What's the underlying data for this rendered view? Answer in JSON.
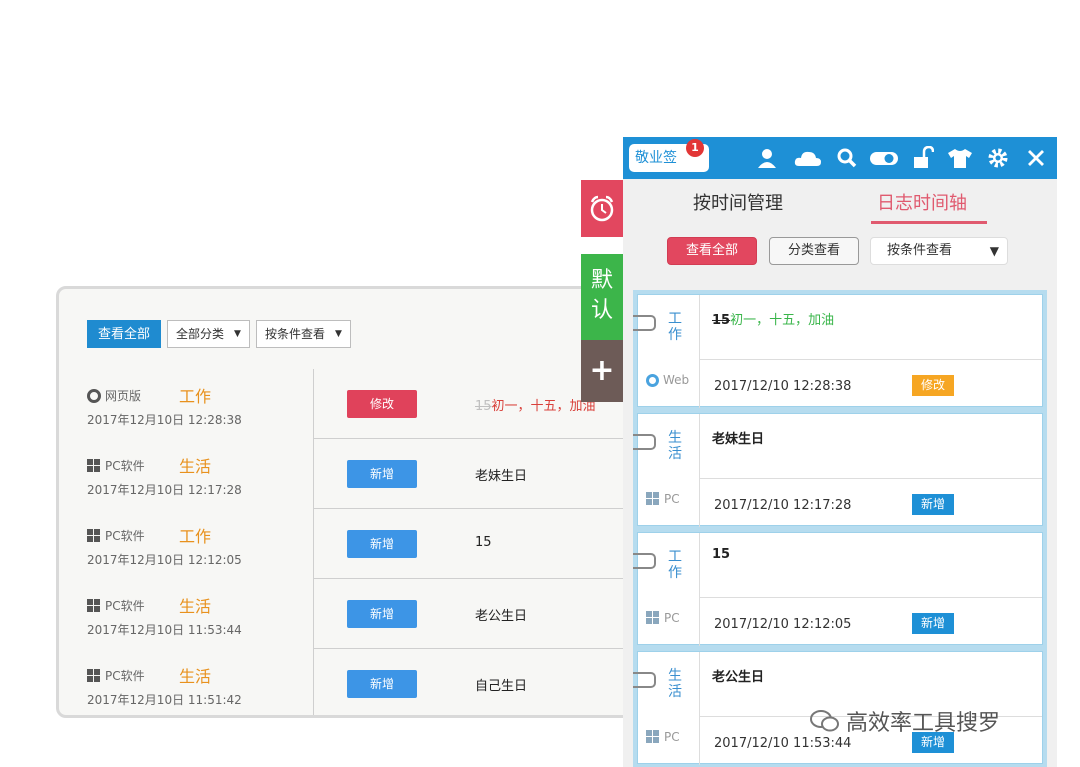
{
  "left": {
    "toolbar": {
      "view_all": "查看全部",
      "category_select": "全部分类",
      "condition_select": "按条件查看"
    },
    "rows": [
      {
        "source": "网页版",
        "source_icon": "ie-icon",
        "category": "工作",
        "time": "2017年12月10日 12:28:38",
        "action": "修改",
        "content_prefix": "15",
        "content": "初一，十五，加油"
      },
      {
        "source": "PC软件",
        "source_icon": "windows-icon",
        "category": "生活",
        "time": "2017年12月10日 12:17:28",
        "action": "新增",
        "content_prefix": "",
        "content": "老妹生日"
      },
      {
        "source": "PC软件",
        "source_icon": "windows-icon",
        "category": "工作",
        "time": "2017年12月10日 12:12:05",
        "action": "新增",
        "content_prefix": "",
        "content": "15"
      },
      {
        "source": "PC软件",
        "source_icon": "windows-icon",
        "category": "生活",
        "time": "2017年12月10日 11:53:44",
        "action": "新增",
        "content_prefix": "",
        "content": "老公生日"
      },
      {
        "source": "PC软件",
        "source_icon": "windows-icon",
        "category": "生活",
        "time": "2017年12月10日 11:51:42",
        "action": "新增",
        "content_prefix": "",
        "content": "自己生日"
      }
    ]
  },
  "side_tabs": {
    "alarm_icon": "alarm-clock-icon",
    "default_label_line1": "默",
    "default_label_line2": "认",
    "add_label": "+"
  },
  "app": {
    "logo": "敬业签",
    "notification_count": "1",
    "toolbar_icons": [
      "user-icon",
      "cloud-icon",
      "search-icon",
      "toggle-icon",
      "lock-icon",
      "shirt-icon",
      "gear-icon",
      "close-icon"
    ],
    "tabs": {
      "by_time": "按时间管理",
      "timeline": "日志时间轴"
    },
    "filters": {
      "view_all": "查看全部",
      "by_category": "分类查看",
      "by_condition": "按条件查看"
    },
    "cards": [
      {
        "category": "工作",
        "title_prefix": "15",
        "title": "初一，十五，加油",
        "source": "Web",
        "time": "2017/12/10 12:28:38",
        "badge": "修改",
        "badge_color": "#f6a623"
      },
      {
        "category": "生活",
        "title_prefix": "",
        "title": "老妹生日",
        "source": "PC",
        "time": "2017/12/10 12:17:28",
        "badge": "新增",
        "badge_color": "#1e90d6"
      },
      {
        "category": "工作",
        "title_prefix": "",
        "title": "15",
        "source": "PC",
        "time": "2017/12/10 12:12:05",
        "badge": "新增",
        "badge_color": "#1e90d6"
      },
      {
        "category": "生活",
        "title_prefix": "",
        "title": "老公生日",
        "source": "PC",
        "time": "2017/12/10 11:53:44",
        "badge": "新增",
        "badge_color": "#1e90d6"
      }
    ]
  },
  "watermark": "高效率工具搜罗"
}
